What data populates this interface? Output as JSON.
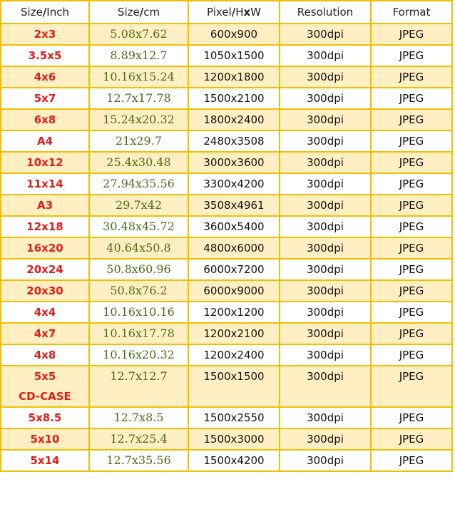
{
  "headers": {
    "size_inch": [
      "Size",
      "/",
      "Inch"
    ],
    "size_cm": [
      "Size",
      "/",
      "cm"
    ],
    "pixel": [
      "Pixel",
      "/",
      "H",
      "x",
      "W"
    ],
    "resolution": "Resolution",
    "format": "Format"
  },
  "rows": [
    {
      "inch": "2x3",
      "cm": "5.08x7.62",
      "pixel": "600x900",
      "resolution": "300dpi",
      "format": "JPEG"
    },
    {
      "inch": "3.5x5",
      "cm": "8.89x12.7",
      "pixel": "1050x1500",
      "resolution": "300dpi",
      "format": "JPEG"
    },
    {
      "inch": "4x6",
      "cm": "10.16x15.24",
      "pixel": "1200x1800",
      "resolution": "300dpi",
      "format": "JPEG"
    },
    {
      "inch": "5x7",
      "cm": "12.7x17.78",
      "pixel": "1500x2100",
      "resolution": "300dpi",
      "format": "JPEG"
    },
    {
      "inch": "6x8",
      "cm": "15.24x20.32",
      "pixel": "1800x2400",
      "resolution": "300dpi",
      "format": "JPEG"
    },
    {
      "inch": "A4",
      "cm": "21x29.7",
      "pixel": "2480x3508",
      "resolution": "300dpi",
      "format": "JPEG"
    },
    {
      "inch": "10x12",
      "cm": "25.4x30.48",
      "pixel": "3000x3600",
      "resolution": "300dpi",
      "format": "JPEG"
    },
    {
      "inch": "11x14",
      "cm": "27.94x35.56",
      "pixel": "3300x4200",
      "resolution": "300dpi",
      "format": "JPEG"
    },
    {
      "inch": "A3",
      "cm": "29.7x42",
      "pixel": "3508x4961",
      "resolution": "300dpi",
      "format": "JPEG"
    },
    {
      "inch": "12x18",
      "cm": "30.48x45.72",
      "pixel": "3600x5400",
      "resolution": "300dpi",
      "format": "JPEG"
    },
    {
      "inch": "16x20",
      "cm": "40.64x50.8",
      "pixel": "4800x6000",
      "resolution": "300dpi",
      "format": "JPEG"
    },
    {
      "inch": "20x24",
      "cm": "50.8x60.96",
      "pixel": "6000x7200",
      "resolution": "300dpi",
      "format": "JPEG"
    },
    {
      "inch": "20x30",
      "cm": "50.8x76.2",
      "pixel": "6000x9000",
      "resolution": "300dpi",
      "format": "JPEG"
    },
    {
      "inch": "4x4",
      "cm": "10.16x10.16",
      "pixel": "1200x1200",
      "resolution": "300dpi",
      "format": "JPEG"
    },
    {
      "inch": "4x7",
      "cm": "10.16x17.78",
      "pixel": "1200x2100",
      "resolution": "300dpi",
      "format": "JPEG"
    },
    {
      "inch": "4x8",
      "cm": "10.16x20.32",
      "pixel": "1200x2400",
      "resolution": "300dpi",
      "format": "JPEG"
    },
    {
      "inch": "5x5",
      "inch_note": "CD-CASE",
      "cm": "12.7x12.7",
      "pixel": "1500x1500",
      "resolution": "300dpi",
      "format": "JPEG"
    },
    {
      "inch": "5x8.5",
      "cm": "12.7x8.5",
      "pixel": "1500x2550",
      "resolution": "300dpi",
      "format": "JPEG"
    },
    {
      "inch": "5x10",
      "cm": "12.7x25.4",
      "pixel": "1500x3000",
      "resolution": "300dpi",
      "format": "JPEG"
    },
    {
      "inch": "5x14",
      "cm": "12.7x35.56",
      "pixel": "1500x4200",
      "resolution": "300dpi",
      "format": "JPEG"
    }
  ],
  "colors": {
    "border": "#F0C000",
    "alt_row": "#FFEFC2",
    "inch_text": "#E31C1C",
    "cm_text": "#4B6E1A"
  }
}
